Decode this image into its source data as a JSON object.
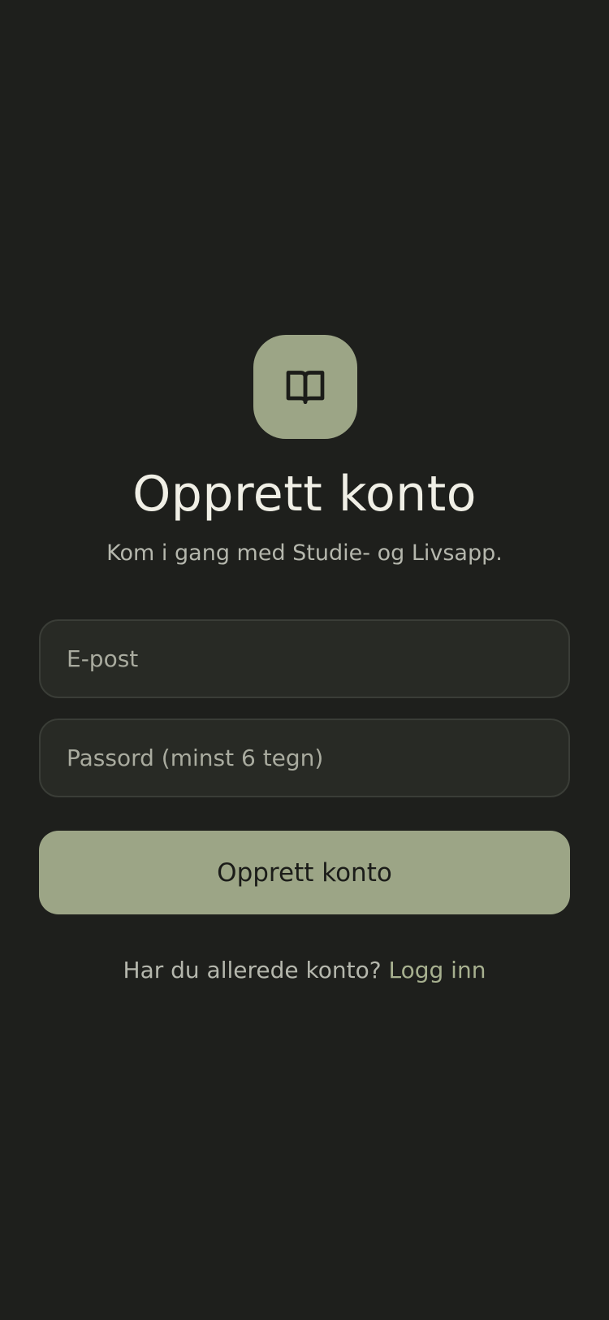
{
  "logo": {
    "icon": "open-book-icon",
    "background": "#9ca586"
  },
  "header": {
    "title": "Opprett konto",
    "subtitle": "Kom i gang med Studie- og Livsapp."
  },
  "form": {
    "email": {
      "placeholder": "E-post",
      "value": ""
    },
    "password": {
      "placeholder": "Passord (minst 6 tegn)",
      "value": ""
    },
    "submit_label": "Opprett konto"
  },
  "footer": {
    "prompt": "Har du allerede konto?",
    "login_label": "Logg inn"
  },
  "colors": {
    "background": "#1e1f1c",
    "accent": "#9ca586",
    "field_background": "#282a25",
    "title_text": "#f0efe6",
    "muted_text": "#b5b7ad"
  }
}
